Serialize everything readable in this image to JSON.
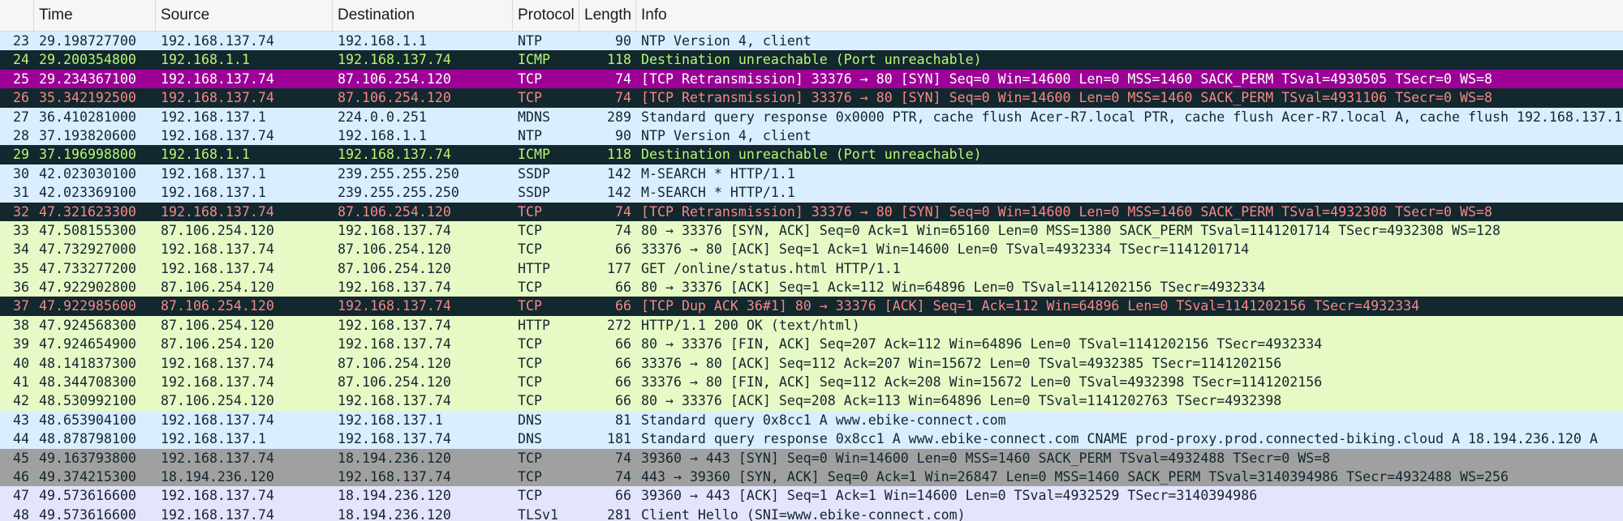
{
  "columns": {
    "no": "",
    "time": "Time",
    "source": "Source",
    "destination": "Destination",
    "protocol": "Protocol",
    "length": "Length",
    "info": "Info"
  },
  "colors": {
    "udp": {
      "bg": "#daeeff",
      "fg": "#12272e"
    },
    "tcp": {
      "bg": "#e7f9c5",
      "fg": "#12272e"
    },
    "icmp_error": {
      "bg": "#12272e",
      "fg": "#b7f774"
    },
    "tcp_error": {
      "bg": "#12272e",
      "fg": "#f78787"
    },
    "syn_fin": {
      "bg": "#a0a0a0",
      "fg": "#12272e"
    },
    "tls": {
      "bg": "#e4e4fc",
      "fg": "#12272e"
    },
    "selected": {
      "bg": "#9d0097",
      "fg": "#ffffff"
    }
  },
  "packets": [
    {
      "no": "23",
      "time": "29.198727700",
      "source": "192.168.137.74",
      "destination": "192.168.1.1",
      "protocol": "NTP",
      "length": "90",
      "info": "NTP Version 4, client",
      "style": "udp"
    },
    {
      "no": "24",
      "time": "29.200354800",
      "source": "192.168.1.1",
      "destination": "192.168.137.74",
      "protocol": "ICMP",
      "length": "118",
      "info": "Destination unreachable (Port unreachable)",
      "style": "icmp_error"
    },
    {
      "no": "25",
      "time": "29.234367100",
      "source": "192.168.137.74",
      "destination": "87.106.254.120",
      "protocol": "TCP",
      "length": "74",
      "info": "[TCP Retransmission] 33376 → 80 [SYN] Seq=0 Win=14600 Len=0 MSS=1460 SACK_PERM TSval=4930505 TSecr=0 WS=8",
      "style": "selected"
    },
    {
      "no": "26",
      "time": "35.342192500",
      "source": "192.168.137.74",
      "destination": "87.106.254.120",
      "protocol": "TCP",
      "length": "74",
      "info": "[TCP Retransmission] 33376 → 80 [SYN] Seq=0 Win=14600 Len=0 MSS=1460 SACK_PERM TSval=4931106 TSecr=0 WS=8",
      "style": "tcp_error"
    },
    {
      "no": "27",
      "time": "36.410281000",
      "source": "192.168.137.1",
      "destination": "224.0.0.251",
      "protocol": "MDNS",
      "length": "289",
      "info": "Standard query response 0x0000 PTR, cache flush Acer-R7.local PTR, cache flush Acer-R7.local A, cache flush 192.168.137.1",
      "style": "udp"
    },
    {
      "no": "28",
      "time": "37.193820600",
      "source": "192.168.137.74",
      "destination": "192.168.1.1",
      "protocol": "NTP",
      "length": "90",
      "info": "NTP Version 4, client",
      "style": "udp"
    },
    {
      "no": "29",
      "time": "37.196998800",
      "source": "192.168.1.1",
      "destination": "192.168.137.74",
      "protocol": "ICMP",
      "length": "118",
      "info": "Destination unreachable (Port unreachable)",
      "style": "icmp_error"
    },
    {
      "no": "30",
      "time": "42.023030100",
      "source": "192.168.137.1",
      "destination": "239.255.255.250",
      "protocol": "SSDP",
      "length": "142",
      "info": "M-SEARCH * HTTP/1.1",
      "style": "udp"
    },
    {
      "no": "31",
      "time": "42.023369100",
      "source": "192.168.137.1",
      "destination": "239.255.255.250",
      "protocol": "SSDP",
      "length": "142",
      "info": "M-SEARCH * HTTP/1.1",
      "style": "udp"
    },
    {
      "no": "32",
      "time": "47.321623300",
      "source": "192.168.137.74",
      "destination": "87.106.254.120",
      "protocol": "TCP",
      "length": "74",
      "info": "[TCP Retransmission] 33376 → 80 [SYN] Seq=0 Win=14600 Len=0 MSS=1460 SACK_PERM TSval=4932308 TSecr=0 WS=8",
      "style": "tcp_error"
    },
    {
      "no": "33",
      "time": "47.508155300",
      "source": "87.106.254.120",
      "destination": "192.168.137.74",
      "protocol": "TCP",
      "length": "74",
      "info": "80 → 33376 [SYN, ACK] Seq=0 Ack=1 Win=65160 Len=0 MSS=1380 SACK_PERM TSval=1141201714 TSecr=4932308 WS=128",
      "style": "tcp"
    },
    {
      "no": "34",
      "time": "47.732927000",
      "source": "192.168.137.74",
      "destination": "87.106.254.120",
      "protocol": "TCP",
      "length": "66",
      "info": "33376 → 80 [ACK] Seq=1 Ack=1 Win=14600 Len=0 TSval=4932334 TSecr=1141201714",
      "style": "tcp"
    },
    {
      "no": "35",
      "time": "47.733277200",
      "source": "192.168.137.74",
      "destination": "87.106.254.120",
      "protocol": "HTTP",
      "length": "177",
      "info": "GET /online/status.html HTTP/1.1",
      "style": "tcp"
    },
    {
      "no": "36",
      "time": "47.922902800",
      "source": "87.106.254.120",
      "destination": "192.168.137.74",
      "protocol": "TCP",
      "length": "66",
      "info": "80 → 33376 [ACK] Seq=1 Ack=112 Win=64896 Len=0 TSval=1141202156 TSecr=4932334",
      "style": "tcp"
    },
    {
      "no": "37",
      "time": "47.922985600",
      "source": "87.106.254.120",
      "destination": "192.168.137.74",
      "protocol": "TCP",
      "length": "66",
      "info": "[TCP Dup ACK 36#1] 80 → 33376 [ACK] Seq=1 Ack=112 Win=64896 Len=0 TSval=1141202156 TSecr=4932334",
      "style": "tcp_error"
    },
    {
      "no": "38",
      "time": "47.924568300",
      "source": "87.106.254.120",
      "destination": "192.168.137.74",
      "protocol": "HTTP",
      "length": "272",
      "info": "HTTP/1.1 200 OK  (text/html)",
      "style": "tcp"
    },
    {
      "no": "39",
      "time": "47.924654900",
      "source": "87.106.254.120",
      "destination": "192.168.137.74",
      "protocol": "TCP",
      "length": "66",
      "info": "80 → 33376 [FIN, ACK] Seq=207 Ack=112 Win=64896 Len=0 TSval=1141202156 TSecr=4932334",
      "style": "tcp"
    },
    {
      "no": "40",
      "time": "48.141837300",
      "source": "192.168.137.74",
      "destination": "87.106.254.120",
      "protocol": "TCP",
      "length": "66",
      "info": "33376 → 80 [ACK] Seq=112 Ack=207 Win=15672 Len=0 TSval=4932385 TSecr=1141202156",
      "style": "tcp"
    },
    {
      "no": "41",
      "time": "48.344708300",
      "source": "192.168.137.74",
      "destination": "87.106.254.120",
      "protocol": "TCP",
      "length": "66",
      "info": "33376 → 80 [FIN, ACK] Seq=112 Ack=208 Win=15672 Len=0 TSval=4932398 TSecr=1141202156",
      "style": "tcp"
    },
    {
      "no": "42",
      "time": "48.530992100",
      "source": "87.106.254.120",
      "destination": "192.168.137.74",
      "protocol": "TCP",
      "length": "66",
      "info": "80 → 33376 [ACK] Seq=208 Ack=113 Win=64896 Len=0 TSval=1141202763 TSecr=4932398",
      "style": "tcp"
    },
    {
      "no": "43",
      "time": "48.653904100",
      "source": "192.168.137.74",
      "destination": "192.168.137.1",
      "protocol": "DNS",
      "length": "81",
      "info": "Standard query 0x8cc1 A www.ebike-connect.com",
      "style": "udp"
    },
    {
      "no": "44",
      "time": "48.878798100",
      "source": "192.168.137.1",
      "destination": "192.168.137.74",
      "protocol": "DNS",
      "length": "181",
      "info": "Standard query response 0x8cc1 A www.ebike-connect.com CNAME prod-proxy.prod.connected-biking.cloud A 18.194.236.120 A",
      "style": "udp"
    },
    {
      "no": "45",
      "time": "49.163793800",
      "source": "192.168.137.74",
      "destination": "18.194.236.120",
      "protocol": "TCP",
      "length": "74",
      "info": "39360 → 443 [SYN] Seq=0 Win=14600 Len=0 MSS=1460 SACK_PERM TSval=4932488 TSecr=0 WS=8",
      "style": "syn_fin"
    },
    {
      "no": "46",
      "time": "49.374215300",
      "source": "18.194.236.120",
      "destination": "192.168.137.74",
      "protocol": "TCP",
      "length": "74",
      "info": "443 → 39360 [SYN, ACK] Seq=0 Ack=1 Win=26847 Len=0 MSS=1460 SACK_PERM TSval=3140394986 TSecr=4932488 WS=256",
      "style": "syn_fin"
    },
    {
      "no": "47",
      "time": "49.573616600",
      "source": "192.168.137.74",
      "destination": "18.194.236.120",
      "protocol": "TCP",
      "length": "66",
      "info": "39360 → 443 [ACK] Seq=1 Ack=1 Win=14600 Len=0 TSval=4932529 TSecr=3140394986",
      "style": "tls"
    },
    {
      "no": "48",
      "time": "49.573616600",
      "source": "192.168.137.74",
      "destination": "18.194.236.120",
      "protocol": "TLSv1",
      "length": "281",
      "info": "Client Hello (SNI=www.ebike-connect.com)",
      "style": "tls"
    }
  ]
}
